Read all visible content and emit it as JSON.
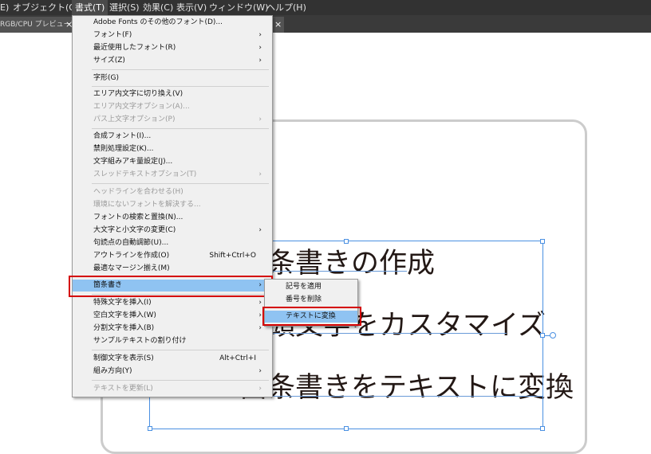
{
  "menubar": {
    "items": [
      {
        "label": "E)"
      },
      {
        "label": "オブジェクト(O)"
      },
      {
        "label": "書式(T)"
      },
      {
        "label": "選択(S)"
      },
      {
        "label": "効果(C)"
      },
      {
        "label": "表示(V)"
      },
      {
        "label": "ウィンドウ(W)"
      },
      {
        "label": "ヘルプ(H)"
      }
    ]
  },
  "tabbar": {
    "tab_label": "RGB/CPU プレビュー)",
    "close_glyph": "×"
  },
  "document": {
    "headings": [
      "箇条書きの作成",
      "行頭文字をカスタマイズ",
      "箇条書きをテキストに変換"
    ]
  },
  "type_menu": {
    "items": [
      {
        "label": "Adobe Fonts のその他のフォント(D)...",
        "shortcut": "",
        "submenu": false,
        "disabled": false
      },
      {
        "label": "フォント(F)",
        "shortcut": "",
        "submenu": true,
        "disabled": false
      },
      {
        "label": "最近使用したフォント(R)",
        "shortcut": "",
        "submenu": true,
        "disabled": false
      },
      {
        "label": "サイズ(Z)",
        "shortcut": "",
        "submenu": true,
        "disabled": false
      },
      {
        "label": "字形(G)",
        "shortcut": "",
        "submenu": false,
        "disabled": false
      },
      {
        "label": "エリア内文字に切り換え(V)",
        "shortcut": "",
        "submenu": false,
        "disabled": false
      },
      {
        "label": "エリア内文字オプション(A)...",
        "shortcut": "",
        "submenu": false,
        "disabled": true
      },
      {
        "label": "パス上文字オプション(P)",
        "shortcut": "",
        "submenu": true,
        "disabled": true
      },
      {
        "label": "合成フォント(I)...",
        "shortcut": "",
        "submenu": false,
        "disabled": false
      },
      {
        "label": "禁則処理設定(K)...",
        "shortcut": "",
        "submenu": false,
        "disabled": false
      },
      {
        "label": "文字組みアキ量設定(J)...",
        "shortcut": "",
        "submenu": false,
        "disabled": false
      },
      {
        "label": "スレッドテキストオプション(T)",
        "shortcut": "",
        "submenu": true,
        "disabled": true
      },
      {
        "label": "ヘッドラインを合わせる(H)",
        "shortcut": "",
        "submenu": false,
        "disabled": true
      },
      {
        "label": "環境にないフォントを解決する...",
        "shortcut": "",
        "submenu": false,
        "disabled": true
      },
      {
        "label": "フォントの検索と置換(N)...",
        "shortcut": "",
        "submenu": false,
        "disabled": false
      },
      {
        "label": "大文字と小文字の変更(C)",
        "shortcut": "",
        "submenu": true,
        "disabled": false
      },
      {
        "label": "句読点の自動調節(U)...",
        "shortcut": "",
        "submenu": false,
        "disabled": false
      },
      {
        "label": "アウトラインを作成(O)",
        "shortcut": "Shift+Ctrl+O",
        "submenu": false,
        "disabled": false
      },
      {
        "label": "最適なマージン揃え(M)",
        "shortcut": "",
        "submenu": false,
        "disabled": false
      },
      {
        "label": "箇条書き",
        "shortcut": "",
        "submenu": true,
        "disabled": false
      },
      {
        "label": "特殊文字を挿入(I)",
        "shortcut": "",
        "submenu": true,
        "disabled": false
      },
      {
        "label": "空白文字を挿入(W)",
        "shortcut": "",
        "submenu": true,
        "disabled": false
      },
      {
        "label": "分割文字を挿入(B)",
        "shortcut": "",
        "submenu": true,
        "disabled": false
      },
      {
        "label": "サンプルテキストの割り付け",
        "shortcut": "",
        "submenu": false,
        "disabled": false
      },
      {
        "label": "制御文字を表示(S)",
        "shortcut": "Alt+Ctrl+I",
        "submenu": false,
        "disabled": false
      },
      {
        "label": "組み方向(Y)",
        "shortcut": "",
        "submenu": true,
        "disabled": false
      },
      {
        "label": "テキストを更新(L)",
        "shortcut": "",
        "submenu": true,
        "disabled": true
      }
    ]
  },
  "bullets_submenu": {
    "items": [
      {
        "label": "記号を適用"
      },
      {
        "label": "番号を削除"
      },
      {
        "label": "テキストに変換"
      }
    ]
  },
  "colors": {
    "menubar_bg": "#323232",
    "menu_bg": "#f0f0f0",
    "highlight": "#8fc3f2",
    "annotation_red": "#d40000",
    "selection_blue": "#4a90e2"
  },
  "icons": {
    "submenu_arrow": "chevron-right-icon",
    "tab_close": "close-icon"
  }
}
